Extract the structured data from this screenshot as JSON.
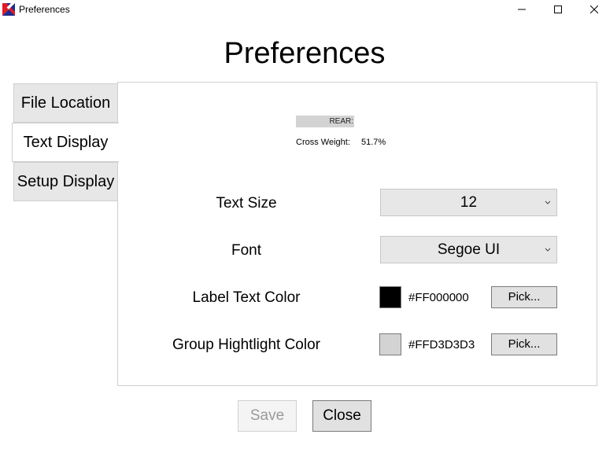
{
  "window": {
    "title": "Preferences",
    "controls": [
      "minimize",
      "maximize",
      "close"
    ]
  },
  "page_title": "Preferences",
  "tabs": [
    {
      "label": "File Location",
      "active": false
    },
    {
      "label": "Text Display",
      "active": true
    },
    {
      "label": "Setup Display",
      "active": false
    }
  ],
  "preview": {
    "bar_text": "REAR:",
    "bar_color": "#D3D3D3",
    "cross_weight_label": "Cross Weight:",
    "cross_weight_value": "51.7%"
  },
  "settings": {
    "text_size": {
      "label": "Text Size",
      "value": "12"
    },
    "font": {
      "label": "Font",
      "value": "Segoe UI"
    },
    "label_text_color": {
      "label": "Label Text Color",
      "value": "#FF000000",
      "swatch": "#000000",
      "pick_label": "Pick..."
    },
    "group_highlight_color": {
      "label": "Group Hightlight Color",
      "value": "#FFD3D3D3",
      "swatch": "#D3D3D3",
      "pick_label": "Pick..."
    }
  },
  "footer": {
    "save_label": "Save",
    "save_enabled": false,
    "close_label": "Close"
  }
}
